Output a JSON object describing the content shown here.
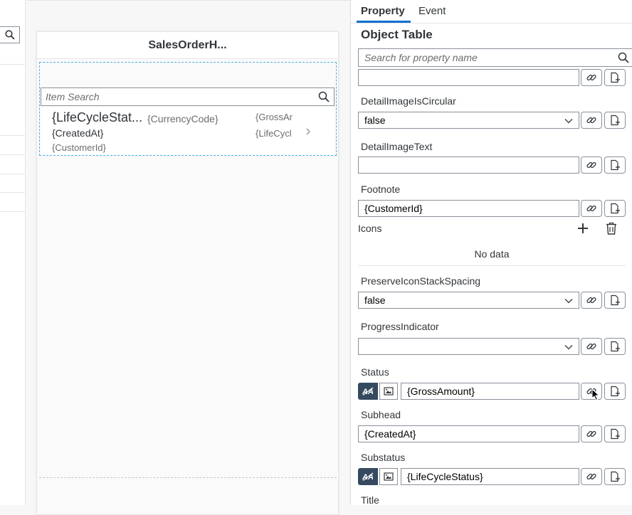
{
  "canvas": {
    "page_title": "SalesOrderH...",
    "item_search_placeholder": "Item Search",
    "list_item": {
      "title": "{LifeCycleStat...",
      "currency": "{CurrencyCode}",
      "gross": "{GrossAr",
      "created": "{CreatedAt}",
      "lifecycle": "{LifeCycl",
      "customer": "{CustomerId}"
    }
  },
  "panel": {
    "tabs": {
      "property": "Property",
      "event": "Event"
    },
    "title": "Object Table",
    "search_placeholder": "Search for property name",
    "top_field_value": "",
    "detail_image_is_circular": {
      "label": "DetailImageIsCircular",
      "value": "false"
    },
    "detail_image_text": {
      "label": "DetailImageText",
      "value": ""
    },
    "footnote": {
      "label": "Footnote",
      "value": "{CustomerId}"
    },
    "icons": {
      "label": "Icons",
      "no_data": "No data"
    },
    "preserve_icon_stack_spacing": {
      "label": "PreserveIconStackSpacing",
      "value": "false"
    },
    "progress_indicator": {
      "label": "ProgressIndicator",
      "value": ""
    },
    "status": {
      "label": "Status",
      "value": "{GrossAmount}"
    },
    "subhead": {
      "label": "Subhead",
      "value": "{CreatedAt}"
    },
    "substatus": {
      "label": "Substatus",
      "value": "{LifeCycleStatus}"
    },
    "title_prop": {
      "label": "Title"
    }
  },
  "colors": {
    "accent": "#0a6ed1",
    "selection": "#4db1e8",
    "format_button": "#354a5f"
  }
}
